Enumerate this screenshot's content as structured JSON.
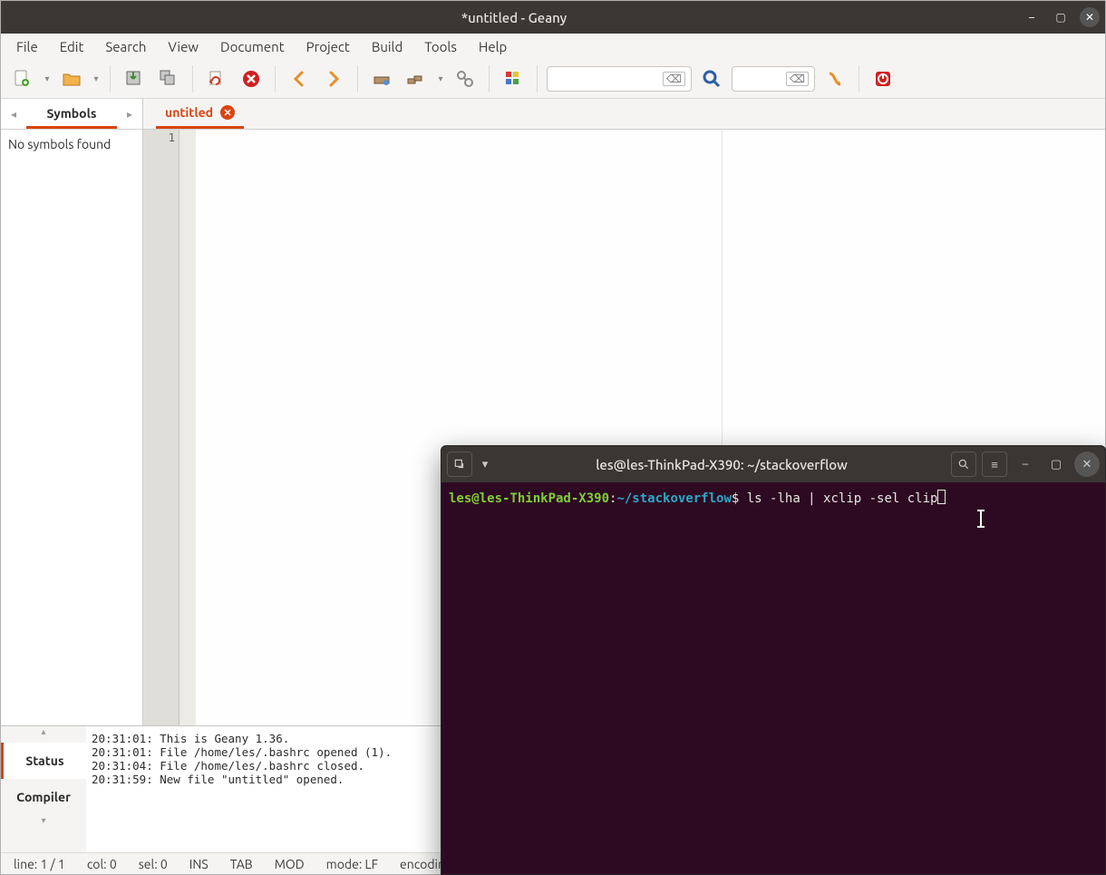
{
  "geany": {
    "title": "*untitled - Geany",
    "menu": {
      "file": "File",
      "edit": "Edit",
      "search": "Search",
      "view": "View",
      "document": "Document",
      "project": "Project",
      "build": "Build",
      "tools": "Tools",
      "help": "Help"
    },
    "sidebar": {
      "tab_label": "Symbols",
      "no_symbols": "No symbols found"
    },
    "doc_tab": {
      "name": "untitled"
    },
    "gutter": {
      "line1": "1"
    },
    "messages": {
      "tab_status": "Status",
      "tab_compiler": "Compiler",
      "log": [
        "20:31:01: This is Geany 1.36.",
        "20:31:01: File /home/les/.bashrc opened (1).",
        "20:31:04: File /home/les/.bashrc closed.",
        "20:31:59: New file \"untitled\" opened."
      ]
    },
    "status": {
      "line": "line: 1 / 1",
      "col": "col: 0",
      "sel": "sel: 0",
      "ins": "INS",
      "tab": "TAB",
      "mod": "MOD",
      "mode": "mode: LF",
      "encoding": "encoding"
    }
  },
  "terminal": {
    "title": "les@les-ThinkPad-X390: ~/stackoverflow",
    "prompt_user": "les@les-ThinkPad-X390",
    "colon": ":",
    "prompt_path": "~/stackoverflow",
    "dollar": "$ ",
    "command": "ls -lha | xclip -sel clip"
  }
}
